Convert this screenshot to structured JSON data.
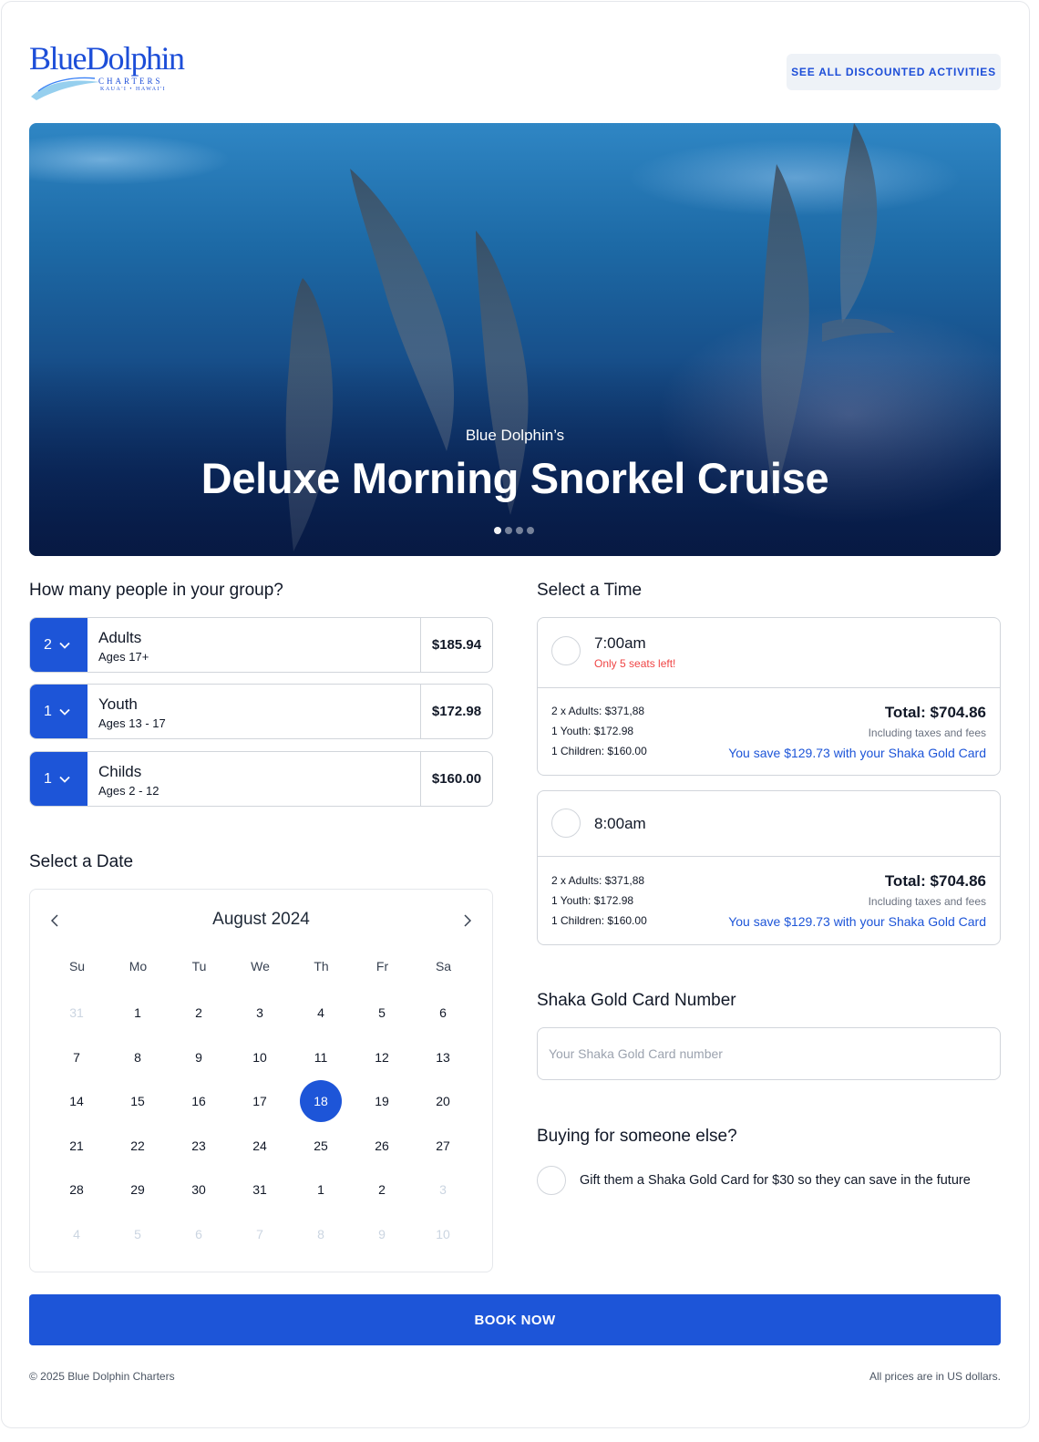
{
  "header": {
    "logo": {
      "wordmark": "BlueDolphin",
      "subtitle": "CHARTERS",
      "location": "KAUA'I • HAWAI'I"
    },
    "discount_button": "SEE ALL DISCOUNTED ACTIVITIES"
  },
  "hero": {
    "subtitle": "Blue Dolphin’s",
    "title": "Deluxe Morning Snorkel Cruise",
    "slide_count": 4,
    "active_slide": 1
  },
  "group": {
    "title": "How many people in your group?",
    "rows": [
      {
        "qty": "2",
        "name": "Adults",
        "ages": "Ages 17+",
        "price": "$185.94"
      },
      {
        "qty": "1",
        "name": "Youth",
        "ages": "Ages 13 - 17",
        "price": "$172.98"
      },
      {
        "qty": "1",
        "name": "Childs",
        "ages": "Ages 2 - 12",
        "price": "$160.00"
      }
    ]
  },
  "date": {
    "title": "Select a Date",
    "month": "August 2024",
    "weekdays": [
      "Su",
      "Mo",
      "Tu",
      "We",
      "Th",
      "Fr",
      "Sa"
    ],
    "weeks": [
      [
        "31",
        "1",
        "2",
        "3",
        "4",
        "5",
        "6"
      ],
      [
        "7",
        "8",
        "9",
        "10",
        "11",
        "12",
        "13"
      ],
      [
        "14",
        "15",
        "16",
        "17",
        "18",
        "19",
        "20"
      ],
      [
        "21",
        "22",
        "23",
        "24",
        "25",
        "26",
        "27"
      ],
      [
        "28",
        "29",
        "30",
        "31",
        "1",
        "2",
        "3"
      ],
      [
        "4",
        "5",
        "6",
        "7",
        "8",
        "9",
        "10"
      ]
    ],
    "selected_day": "18"
  },
  "time": {
    "title": "Select a Time",
    "slots": [
      {
        "time": "7:00am",
        "warning": "Only 5 seats left!",
        "lines": [
          "2 x Adults: $371,88",
          "1 Youth: $172.98",
          "1 Children: $160.00"
        ],
        "total": "Total: $704.86",
        "including": "Including taxes and fees",
        "save": "You save $129.73 with your Shaka Gold Card"
      },
      {
        "time": "8:00am",
        "warning": "",
        "lines": [
          "2 x Adults: $371,88",
          "1 Youth: $172.98",
          "1 Children: $160.00"
        ],
        "total": "Total: $704.86",
        "including": "Including taxes and fees",
        "save": "You save $129.73 with your Shaka Gold Card"
      }
    ]
  },
  "shaka": {
    "title": "Shaka Gold Card Number",
    "placeholder": "Your Shaka Gold Card number",
    "value": ""
  },
  "gift": {
    "title": "Buying for someone else?",
    "label": "Gift them a Shaka Gold Card for $30 so they can save in the future"
  },
  "book_button": "BOOK NOW",
  "footer": {
    "copyright": "© 2025 Blue Dolphin Charters",
    "currency_note": "All prices are in US dollars."
  },
  "colors": {
    "primary": "#1d55d8",
    "warning": "#ef4444",
    "border": "#d1d5db",
    "muted_text": "#6b7280"
  }
}
